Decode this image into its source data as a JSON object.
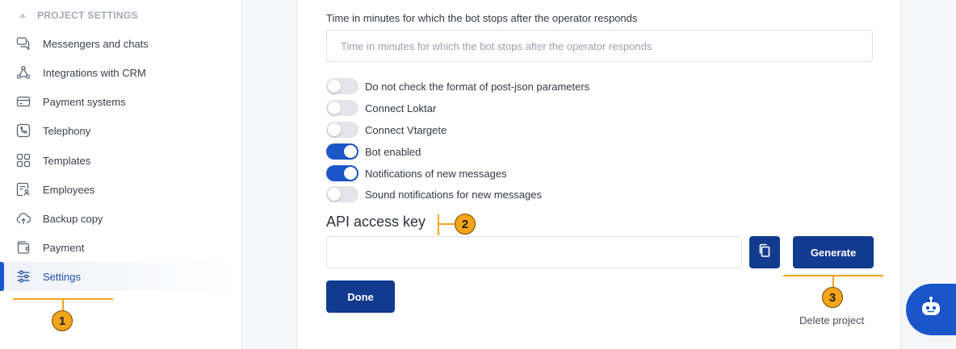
{
  "sidebar": {
    "section_title": "PROJECT SETTINGS",
    "items": [
      {
        "label": "Messengers and chats",
        "icon": "chat-bubbles-icon"
      },
      {
        "label": "Integrations with CRM",
        "icon": "integration-nodes-icon"
      },
      {
        "label": "Payment systems",
        "icon": "credit-card-icon"
      },
      {
        "label": "Telephony",
        "icon": "phone-icon"
      },
      {
        "label": "Templates",
        "icon": "grid-templates-icon"
      },
      {
        "label": "Employees",
        "icon": "employee-card-icon"
      },
      {
        "label": "Backup copy",
        "icon": "cloud-upload-icon"
      },
      {
        "label": "Payment",
        "icon": "wallet-icon"
      },
      {
        "label": "Settings",
        "icon": "sliders-icon",
        "active": true
      }
    ]
  },
  "main": {
    "bot_stop_label": "Time in minutes for which the bot stops after the operator responds",
    "bot_stop_placeholder": "Time in minutes for which the bot stops after the operator responds",
    "toggles": [
      {
        "label": "Do not check the format of post-json parameters",
        "on": false
      },
      {
        "label": "Connect Loktar",
        "on": false
      },
      {
        "label": "Connect Vtargete",
        "on": false
      },
      {
        "label": "Bot enabled",
        "on": true
      },
      {
        "label": "Notifications of new messages",
        "on": true
      },
      {
        "label": "Sound notifications for new messages",
        "on": false
      }
    ],
    "api_title": "API access key",
    "api_value": "",
    "generate_label": "Generate",
    "done_label": "Done",
    "delete_label": "Delete project"
  },
  "callouts": [
    "1",
    "2",
    "3"
  ],
  "colors": {
    "accent": "#1b56c9",
    "button_dark": "#123a8f",
    "callout": "#f4a51c"
  }
}
